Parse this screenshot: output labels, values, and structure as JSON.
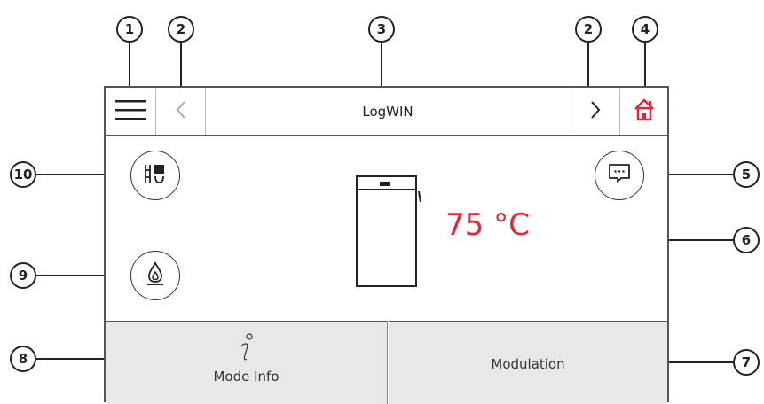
{
  "callouts": [
    "1",
    "2",
    "3",
    "2",
    "4",
    "10",
    "5",
    "6",
    "9",
    "8",
    "7"
  ],
  "header": {
    "title": "LogWIN"
  },
  "boiler": {
    "temperature": "75 °C"
  },
  "bottom": {
    "mode_info_label": "Mode Info",
    "modulation_label": "Modulation"
  },
  "colors": {
    "accent_red": "#e5263a",
    "panel_gray": "#e8e8e8",
    "border": "#555555"
  },
  "icons": {
    "menu": "hamburger-icon",
    "back": "chevron-left-icon",
    "forward": "chevron-right-icon",
    "home": "home-icon",
    "message": "message-icon",
    "flame": "flame-icon",
    "heating": "heating-icon",
    "info": "info-icon"
  }
}
